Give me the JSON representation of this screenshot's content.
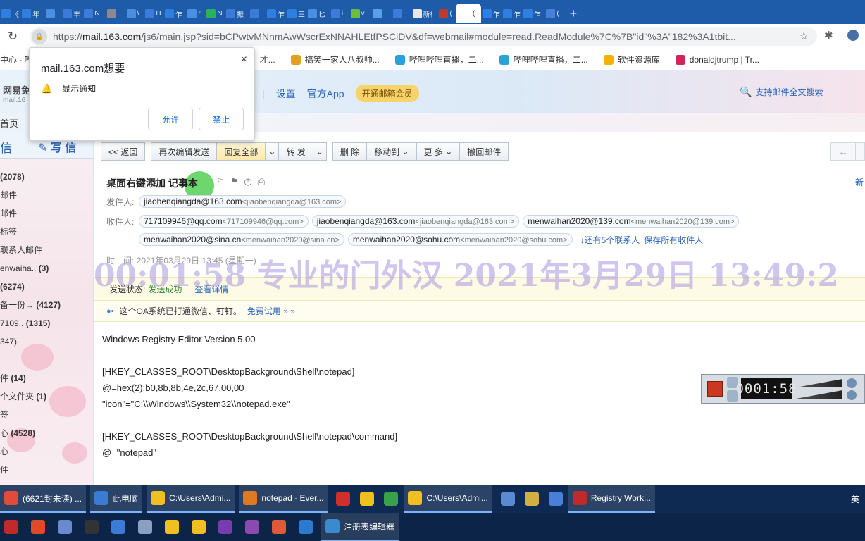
{
  "browser": {
    "tab_labels": [
      "《",
      "年",
      "",
      "丰",
      "N",
      "",
      "\\",
      "H",
      "乍",
      "r",
      "N",
      "振",
      "",
      "乍",
      "三",
      "匕",
      "i",
      "v",
      "",
      "",
      "新标",
      "(",
      "(",
      "乍",
      "乍",
      "乍",
      "("
    ],
    "url_prefix": "https://",
    "url_host": "mail.163.com",
    "url_rest": "/js6/main.jsp?sid=bCPwtvMNnmAwWscrExNNAHLEtfPSCiDV&df=webmail#module=read.ReadModule%7C%7B\"id\"%3A\"182%3A1tbit...",
    "bookmarks": [
      "中心 - 哔",
      "才...",
      "搞笑一家人八叔帅...",
      "哔哩哔哩直播，二...",
      "哔哩哔哩直播，二...",
      "软件资源库",
      "donaldjtrump | Tr..."
    ]
  },
  "popup": {
    "title": "mail.163.com想要",
    "item": "显示通知",
    "allow": "允许",
    "block": "禁止",
    "close": "×"
  },
  "header": {
    "logo": "网易免",
    "logo_sub": "mail.16",
    "nav": [
      "设置",
      "官方App"
    ],
    "vip": "开通邮箱会员",
    "search": "支持邮件全文搜索",
    "home": "首页"
  },
  "sidebar": {
    "receive": "信",
    "write": "写 信",
    "folders": [
      {
        "label": "(2078)",
        "bold": true
      },
      {
        "label": "邮件",
        "bold": false
      },
      {
        "label": "邮件",
        "bold": false
      },
      {
        "label": "标签",
        "bold": false
      },
      {
        "label": "联系人邮件",
        "bold": false
      },
      {
        "label": "enwaiha..",
        "count": "(3)",
        "bold": false
      },
      {
        "label": "(6274)",
        "bold": true
      },
      {
        "label": "备一份→",
        "count": "(4127)",
        "bold": false
      },
      {
        "label": "7109..",
        "count": "(1315)",
        "bold": false
      },
      {
        "label": "347)",
        "bold": false
      },
      {
        "label": "",
        "bold": false
      },
      {
        "label": "件",
        "count": "(14)",
        "bold": false
      },
      {
        "label": "个文件夹",
        "count": "(1)",
        "bold": false
      },
      {
        "label": "签",
        "bold": false
      },
      {
        "label": "心",
        "count": "(4528)",
        "bold": false
      },
      {
        "label": "心",
        "bold": false
      },
      {
        "label": "件",
        "bold": false
      }
    ]
  },
  "toolbar": {
    "back": "<< 返回",
    "reedit": "再次编辑发送",
    "reply_all": "回复全部",
    "forward": "转 发",
    "delete": "删 除",
    "move": "移动到",
    "more": "更 多",
    "recall": "撤回邮件",
    "dropdown_glyph": "⌄",
    "prev_arrow": "←"
  },
  "mail": {
    "subject": "桌面右键添加 记事本",
    "right_cut": "新",
    "from_label": "发件人:",
    "from_name": "jiaobenqiangda@163.com",
    "from_addr": "<jiaobenqiangda@163.com>",
    "to_label": "收件人:",
    "recipients": [
      {
        "name": "717109946@qq.com",
        "addr": "<717109946@qq.com>"
      },
      {
        "name": "jiaobenqiangda@163.com",
        "addr": "<jiaobenqiangda@163.com>"
      },
      {
        "name": "menwaihan2020@139.com",
        "addr": "<menwaihan2020@139.com>"
      },
      {
        "name": "menwaihan2020@sina.cn",
        "addr": "<menwaihan2020@sina.cn>"
      },
      {
        "name": "menwaihan2020@sohu.com",
        "addr": "<menwaihan2020@sohu.com>"
      }
    ],
    "more_contacts": "↓还有5个联系人",
    "save_contacts": "保存所有收件人",
    "time_label": "时　间:",
    "time_value": "2021年03月29日 13:45 (星期一)",
    "status_label": "发送状态:",
    "status_value": "发送成功",
    "status_detail": "查看详情",
    "oa_text": "这个OA系统已打通微信、钉钉。",
    "oa_link": "免费试用 » »",
    "body": "Windows Registry Editor Version 5.00\n\n[HKEY_CLASSES_ROOT\\DesktopBackground\\Shell\\notepad]\n@=hex(2):b0,8b,8b,4e,2c,67,00,00\n\"icon\"=\"C:\\\\Windows\\\\System32\\\\notepad.exe\"\n\n[HKEY_CLASSES_ROOT\\DesktopBackground\\Shell\\notepad\\command]\n@=\"notepad\""
  },
  "watermark": "00:01:58  专业的门外汉  2021年3月29日 13:49:2",
  "recorder": {
    "time": "0001:58"
  },
  "taskbar": {
    "row1": [
      "(6621封未读) ...",
      "此电脑",
      "C:\\Users\\Admi...",
      "notepad - Ever...",
      "",
      "",
      "",
      "C:\\Users\\Admi...",
      "",
      "",
      "",
      "Registry Work..."
    ],
    "row2": [
      "",
      "",
      "",
      "",
      "",
      "",
      "",
      "",
      "",
      "",
      "",
      "",
      "注册表编辑器"
    ],
    "tray_char": "英"
  },
  "colors": {
    "tabstrip": "#1e5ba8",
    "accent_blue": "#2b64b8",
    "success_green": "#2a8a2a",
    "vip_gold": "#f7d36b"
  }
}
